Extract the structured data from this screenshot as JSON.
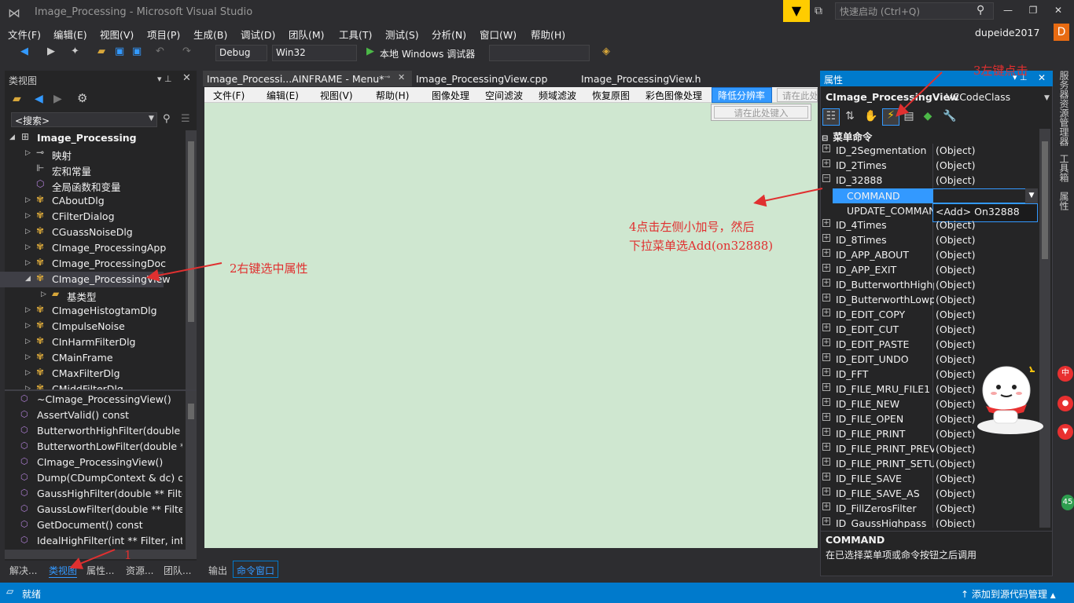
{
  "window": {
    "title": "Image_Processing - Microsoft Visual Studio",
    "quick_launch_placeholder": "快速启动 (Ctrl+Q)",
    "user": "dupeide2017",
    "user_initial": "D"
  },
  "menu": [
    "文件(F)",
    "编辑(E)",
    "视图(V)",
    "项目(P)",
    "生成(B)",
    "调试(D)",
    "团队(M)",
    "工具(T)",
    "测试(S)",
    "分析(N)",
    "窗口(W)",
    "帮助(H)"
  ],
  "toolbar": {
    "config": "Debug",
    "platform": "Win32",
    "run_label": "本地 Windows 调试器"
  },
  "class_view": {
    "title": "类视图",
    "search_placeholder": "<搜索>",
    "project": "Image_Processing",
    "tree": [
      "映射",
      "宏和常量",
      "全局函数和变量",
      "CAboutDlg",
      "CFilterDialog",
      "CGuassNoiseDlg",
      "CImage_ProcessingApp",
      "CImage_ProcessingDoc",
      "CImage_ProcessingView",
      "基类型",
      "CImageHistogtamDlg",
      "CImpulseNoise",
      "CInHarmFilterDlg",
      "CMainFrame",
      "CMaxFilterDlg",
      "CMiddFilterDlg"
    ],
    "members": [
      "~CImage_ProcessingView()",
      "AssertValid() const",
      "ButterworthHighFilter(double ** F",
      "ButterworthLowFilter(double ** Fi",
      "CImage_ProcessingView()",
      "Dump(CDumpContext & dc) con",
      "GaussHighFilter(double ** Filter,",
      "GaussLowFilter(double ** Filter, i",
      "GetDocument() const",
      "IdealHighFilter(int ** Filter, int P,"
    ]
  },
  "bottom_tabs": [
    "解决...",
    "类视图",
    "属性...",
    "资源...",
    "团队..."
  ],
  "output_tabs": [
    "输出",
    "命令窗口"
  ],
  "doc_tabs": [
    "Image_Processi...AINFRAME - Menu*",
    "Image_ProcessingView.cpp",
    "Image_ProcessingView.h"
  ],
  "menu_designer": {
    "items": [
      "文件(F)",
      "编辑(E)",
      "视图(V)",
      "帮助(H)",
      "图像处理",
      "空间滤波",
      "频域滤波",
      "恢复原图",
      "彩色图像处理"
    ],
    "selected": "降低分辨率",
    "type_here": "请在此处键入",
    "type_here_short": "请在此处"
  },
  "properties": {
    "title": "属性",
    "object": "CImage_ProcessingView",
    "object_type": "VCCodeClass",
    "category": "菜单命令",
    "rows": [
      {
        "name": "ID_2Segmentation",
        "value": "(Object)"
      },
      {
        "name": "ID_2Times",
        "value": "(Object)"
      },
      {
        "name": "ID_32888",
        "value": "(Object)"
      },
      {
        "name": "ID_4Times",
        "value": "(Object)"
      },
      {
        "name": "ID_8Times",
        "value": "(Object)"
      },
      {
        "name": "ID_APP_ABOUT",
        "value": "(Object)"
      },
      {
        "name": "ID_APP_EXIT",
        "value": "(Object)"
      },
      {
        "name": "ID_ButterworthHighpa",
        "value": "(Object)"
      },
      {
        "name": "ID_ButterworthLowpa",
        "value": "(Object)"
      },
      {
        "name": "ID_EDIT_COPY",
        "value": "(Object)"
      },
      {
        "name": "ID_EDIT_CUT",
        "value": "(Object)"
      },
      {
        "name": "ID_EDIT_PASTE",
        "value": "(Object)"
      },
      {
        "name": "ID_EDIT_UNDO",
        "value": "(Object)"
      },
      {
        "name": "ID_FFT",
        "value": "(Object)"
      },
      {
        "name": "ID_FILE_MRU_FILE1",
        "value": "(Object)"
      },
      {
        "name": "ID_FILE_NEW",
        "value": "(Object)"
      },
      {
        "name": "ID_FILE_OPEN",
        "value": "(Object)"
      },
      {
        "name": "ID_FILE_PRINT",
        "value": "(Object)"
      },
      {
        "name": "ID_FILE_PRINT_PREVII",
        "value": "(Object)"
      },
      {
        "name": "ID_FILE_PRINT_SETUP",
        "value": "(Object)"
      },
      {
        "name": "ID_FILE_SAVE",
        "value": "(Object)"
      },
      {
        "name": "ID_FILE_SAVE_AS",
        "value": "(Object)"
      },
      {
        "name": "ID_FillZerosFilter",
        "value": "(Object)"
      },
      {
        "name": "ID_GaussHighpass",
        "value": "(Object)"
      }
    ],
    "command": "COMMAND",
    "update_command": "UPDATE_COMMAN",
    "dropdown_option": "<Add> On32888",
    "desc_title": "COMMAND",
    "desc_text": "在已选择菜单项或命令按钮之后调用"
  },
  "side_tabs": [
    "服务器资源管理器",
    "工具箱",
    "属性"
  ],
  "status": {
    "text": "就绪",
    "source_control": "添加到源代码管理"
  },
  "annotations": {
    "a1": "1",
    "a2": "2右键选中属性",
    "a3": "3左键点击",
    "a4_line1": "4点击左侧小加号，然后",
    "a4_line2": "下拉菜单选Add(on32888)"
  },
  "side_badges": {
    "b1": "中",
    "b2": "45"
  },
  "colors": {
    "accent": "#007acc",
    "annotation": "#e03030",
    "editor_bg": "#cfe7d0"
  }
}
